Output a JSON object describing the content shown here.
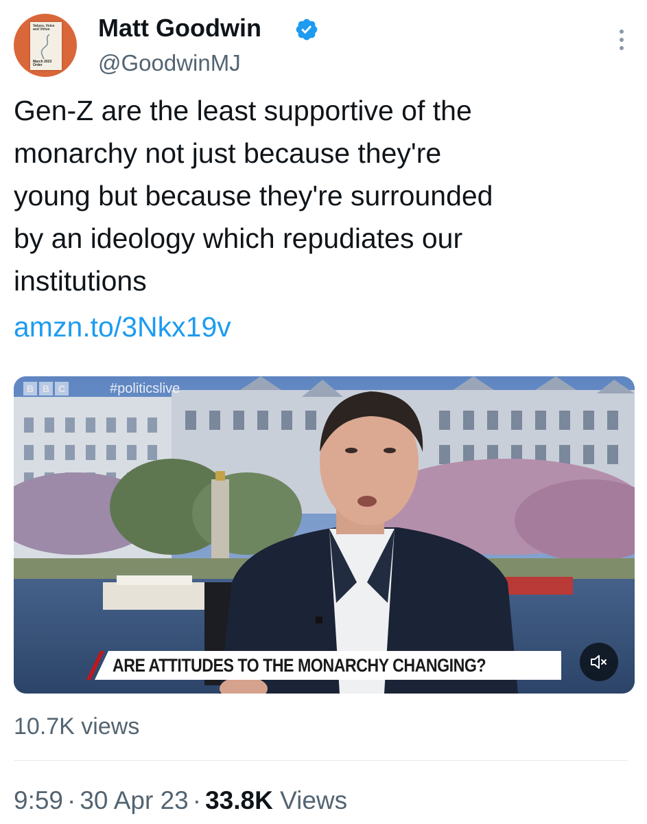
{
  "author": {
    "display_name": "Matt Goodwin",
    "handle": "@GoodwinMJ",
    "verified": true,
    "avatar": {
      "book_title": "Values, Voice and Virtue",
      "book_date": "March 2023 Order"
    }
  },
  "tweet": {
    "text": "Gen-Z are the least supportive of the\nmonarchy not just because they're\nyoung but because they're surrounded\nby an ideology which repudiates our\ninstitutions",
    "link": "amzn.to/3Nkx19v"
  },
  "media": {
    "broadcaster_logo": [
      "B",
      "B",
      "C"
    ],
    "hashtag": "#politicslive",
    "caption": "ARE ATTITUDES TO THE MONARCHY CHANGING?",
    "mute_icon": "volume-muted-icon",
    "video_views": "10.7K views"
  },
  "footer": {
    "time": "9:59",
    "separator": "·",
    "date": "30 Apr 23",
    "views_count": "33.8K",
    "views_label": "Views"
  },
  "colors": {
    "link": "#1d9bf0",
    "secondary_text": "#536471",
    "verified_badge": "#1d9bf0",
    "caption_accent": "#c4161c"
  }
}
